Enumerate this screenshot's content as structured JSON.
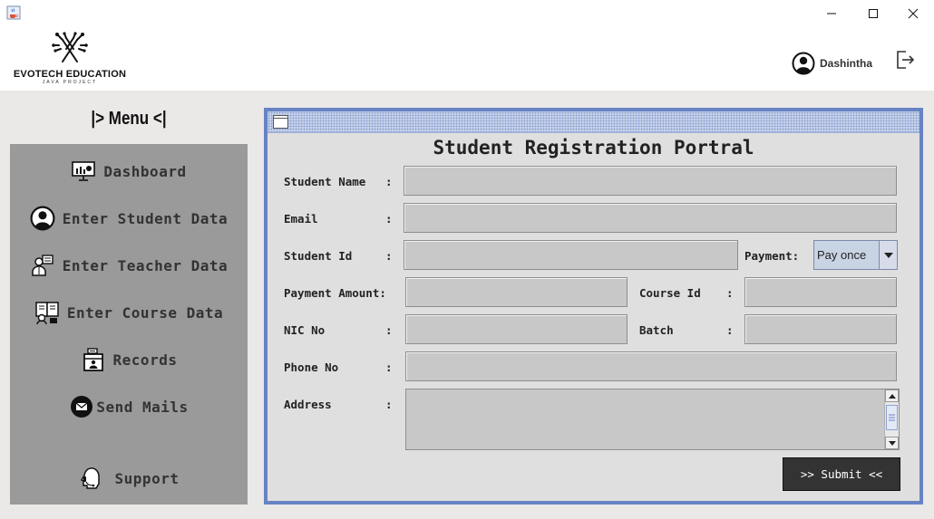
{
  "window": {
    "icon": "java-coffee-icon",
    "controls": [
      "minimize-icon",
      "maximize-icon",
      "close-icon"
    ]
  },
  "header": {
    "logo_title": "EVOTECH EDUCATION",
    "logo_subtitle": "JAVA PROJECT",
    "user_name": "Dashintha",
    "user_icon": "user-avatar-icon",
    "logout_icon": "logout-icon"
  },
  "sidebar": {
    "title": "|> Menu <|",
    "items": [
      {
        "label": "Dashboard",
        "icon": "dashboard-monitor-icon"
      },
      {
        "label": "Enter Student Data",
        "icon": "student-icon"
      },
      {
        "label": "Enter Teacher Data",
        "icon": "teacher-icon"
      },
      {
        "label": "Enter Course Data",
        "icon": "course-icon"
      },
      {
        "label": "Records",
        "icon": "records-icon"
      },
      {
        "label": "Send Mails",
        "icon": "mail-icon"
      },
      {
        "label": "Support",
        "icon": "support-headset-icon"
      }
    ]
  },
  "form": {
    "title": "Student Registration Portral",
    "fields": {
      "student_name": {
        "label": "Student Name",
        "value": ""
      },
      "email": {
        "label": "Email",
        "value": ""
      },
      "student_id": {
        "label": "Student Id",
        "value": ""
      },
      "payment": {
        "label": "Payment:",
        "selected": "Pay once"
      },
      "payment_amount": {
        "label": "Payment Amount:",
        "value": ""
      },
      "course_id": {
        "label": "Course Id",
        "value": ""
      },
      "nic_no": {
        "label": "NIC No",
        "value": ""
      },
      "batch": {
        "label": "Batch",
        "value": ""
      },
      "phone_no": {
        "label": "Phone No",
        "value": ""
      },
      "address": {
        "label": "Address",
        "value": ""
      }
    },
    "colon": ":",
    "submit_label": ">> Submit <<"
  },
  "colors": {
    "sidebar_bg": "#9a9a9a",
    "main_bg": "#ebe8e8",
    "frame_border": "#6783c4",
    "field_bg": "#c8c8c8",
    "submit_bg": "#333333"
  }
}
